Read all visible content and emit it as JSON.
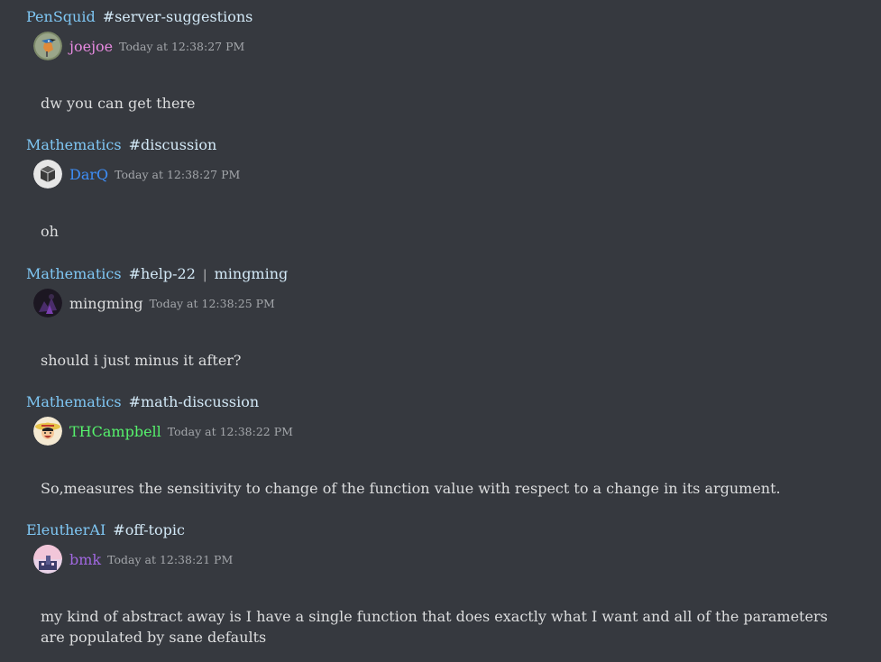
{
  "messages": [
    {
      "server": "PenSquid",
      "channel": "#server-suggestions",
      "thread": "",
      "author": "joejoe",
      "author_color": "#e78ae0",
      "avatar": "kingfisher-bird-avatar",
      "timestamp": "Today at 12:38:27 PM",
      "text": "dw you can get there"
    },
    {
      "server": "Mathematics",
      "channel": "#discussion",
      "thread": "",
      "author": "DarQ",
      "author_color": "#3e8ef7",
      "avatar": "cube-avatar",
      "timestamp": "Today at 12:38:27 PM",
      "text": "oh"
    },
    {
      "server": "Mathematics",
      "channel": "#help-22",
      "thread": "mingming",
      "author": "mingming",
      "author_color": "#dcddde",
      "avatar": "dark-purple-avatar",
      "timestamp": "Today at 12:38:25 PM",
      "text": "should i just minus it after?"
    },
    {
      "server": "Mathematics",
      "channel": "#math-discussion",
      "thread": "",
      "author": "THCampbell",
      "author_color": "#56f26c",
      "avatar": "straw-hat-character-avatar",
      "timestamp": "Today at 12:38:22 PM",
      "text": "So,measures the sensitivity to change of the function value with respect to a change in its argument."
    },
    {
      "server": "EleutherAI",
      "channel": "#off-topic",
      "thread": "",
      "author": "bmk",
      "author_color": "#a168e0",
      "avatar": "pink-sky-avatar",
      "timestamp": "Today at 12:38:21 PM",
      "text": "my kind of abstract away is I have a single function that does exactly what I want and all of the parameters are populated by sane defaults"
    }
  ],
  "colors": {
    "background": "#36393f",
    "server_link": "#7fc7f4",
    "channel_link": "#d3e9f7",
    "timestamp": "#a3a6aa",
    "message_text": "#dcddde"
  }
}
